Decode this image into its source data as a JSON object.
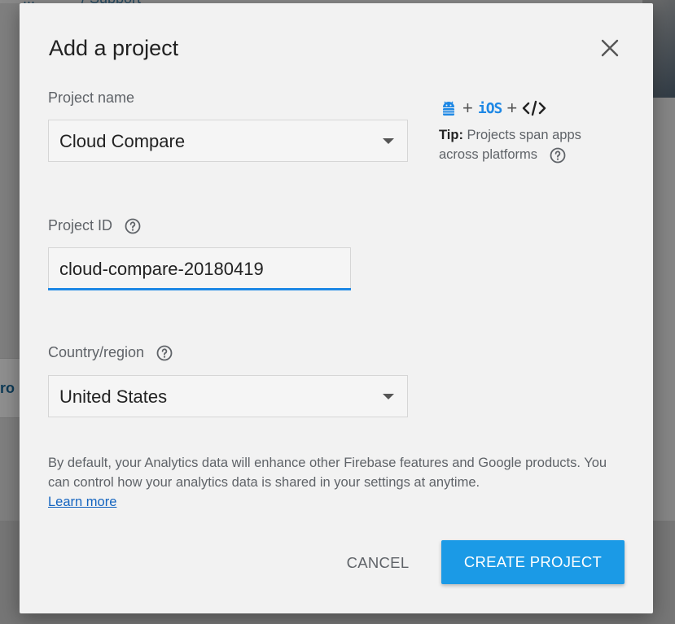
{
  "background": {
    "link_1": "...",
    "link_2": "/ Support",
    "card_fragment": "ro"
  },
  "dialog": {
    "title": "Add a project",
    "close_icon": "close-icon",
    "project_name": {
      "label": "Project name",
      "value": "Cloud Compare"
    },
    "project_id": {
      "label": "Project ID",
      "value": "cloud-compare-20180419",
      "help_icon": "help-circle-icon"
    },
    "country": {
      "label": "Country/region",
      "value": "United States",
      "help_icon": "help-circle-icon"
    },
    "tip": {
      "icons": [
        "android-icon",
        "ios-icon",
        "web-code-icon"
      ],
      "ios_text": "iOS",
      "plus": "+",
      "lead": "Tip:",
      "text": " Projects span apps across platforms",
      "help_icon": "help-circle-icon"
    },
    "notice": {
      "text": "By default, your Analytics data will enhance other Firebase features and Google products. You can control how your analytics data is shared in your settings at anytime.",
      "link": "Learn more"
    },
    "buttons": {
      "cancel": "CANCEL",
      "create": "CREATE PROJECT"
    }
  },
  "colors": {
    "accent": "#1b9ae6",
    "link": "#1565c0",
    "input_underline": "#1e88e5",
    "overlay": "#7f7f7f"
  }
}
